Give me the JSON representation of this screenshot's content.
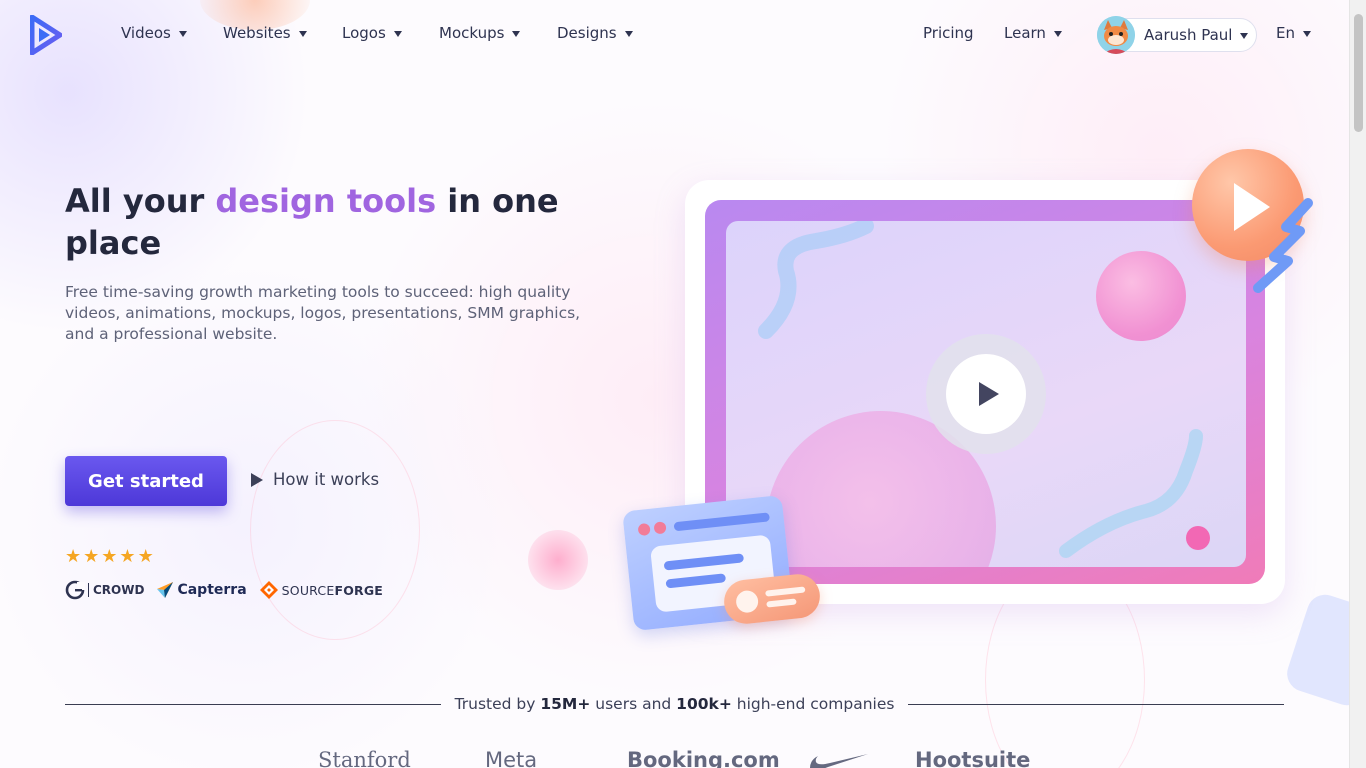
{
  "nav": {
    "items": [
      {
        "label": "Videos"
      },
      {
        "label": "Websites"
      },
      {
        "label": "Logos"
      },
      {
        "label": "Mockups"
      },
      {
        "label": "Designs"
      }
    ],
    "pricing_label": "Pricing",
    "learn_label": "Learn",
    "user_name": "Aarush Paul",
    "language": "En"
  },
  "hero": {
    "title_part1": "All your ",
    "title_accent": "design tools",
    "title_part2": " in one place",
    "subtitle": "Free time-saving growth marketing tools to succeed: high quality videos, animations, mockups, logos, presentations, SMM graphics, and a professional website.",
    "cta_label": "Get started",
    "secondary_label": "How it works",
    "rating_stars": 5
  },
  "review_badges": {
    "g2": "CROWD",
    "g2_mark": "G",
    "capterra": "Capterra",
    "sourceforge_a": "SOURCE",
    "sourceforge_b": "FORGE"
  },
  "trusted": {
    "prefix": "Trusted by ",
    "users": "15M+",
    "middle": " users and ",
    "companies": "100k+",
    "suffix": " high-end companies"
  },
  "brands": [
    "Stanford",
    "Meta",
    "Booking.com",
    "Hootsuite"
  ],
  "colors": {
    "accent_purple": "#a065e0",
    "cta_blue": "#5a45e4",
    "star_gold": "#f5a623"
  }
}
